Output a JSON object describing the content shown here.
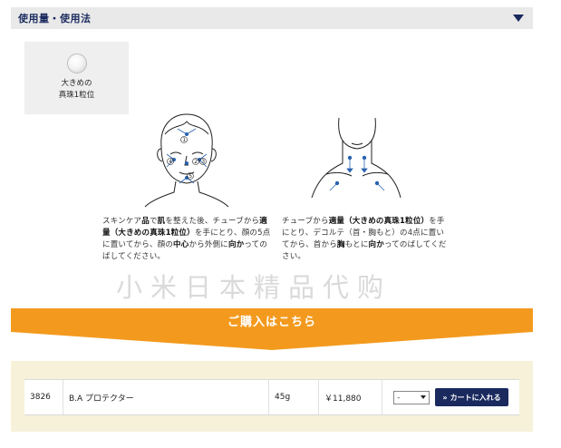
{
  "section": {
    "title": "使用量・使用法"
  },
  "amount": {
    "label": "大きめの\n真珠1粒位",
    "icon": "pearl-icon"
  },
  "instructions": {
    "left": [
      {
        "t": "スキンケア"
      },
      {
        "t": "品",
        "b": true
      },
      {
        "t": "で"
      },
      {
        "t": "肌",
        "b": true
      },
      {
        "t": "を整えた後、チューブから"
      },
      {
        "t": "適量（大きめの真珠1粒位）",
        "b": true
      },
      {
        "t": "を手にとり、顔の5点に置いてから、顔の"
      },
      {
        "t": "中心",
        "b": true
      },
      {
        "t": "から外側に"
      },
      {
        "t": "向か",
        "b": true
      },
      {
        "t": "ってのばしてください。"
      }
    ],
    "right": [
      {
        "t": "チューブから"
      },
      {
        "t": "適量（大きめの真珠1粒位）",
        "b": true
      },
      {
        "t": "を手にとり、デコルテ（首・胸もと）の4点に置いてから、首から"
      },
      {
        "t": "胸",
        "b": true
      },
      {
        "t": "もとに"
      },
      {
        "t": "向か",
        "b": true
      },
      {
        "t": "ってのばしてください。"
      }
    ]
  },
  "watermark": "小米日本精品代购",
  "purchase": {
    "banner_label": "ご購入はこちら",
    "banner_color": "#f39a1e"
  },
  "product": {
    "code": "3826",
    "name": "B.A プロテクター",
    "size": "45g",
    "price": "￥11,880",
    "qty_value": "-",
    "cart_label": "カートに入れる",
    "cart_chevron": "»"
  },
  "colors": {
    "navy": "#1a2a5e",
    "orange": "#f39a1e",
    "panel": "#f6f1d8"
  }
}
